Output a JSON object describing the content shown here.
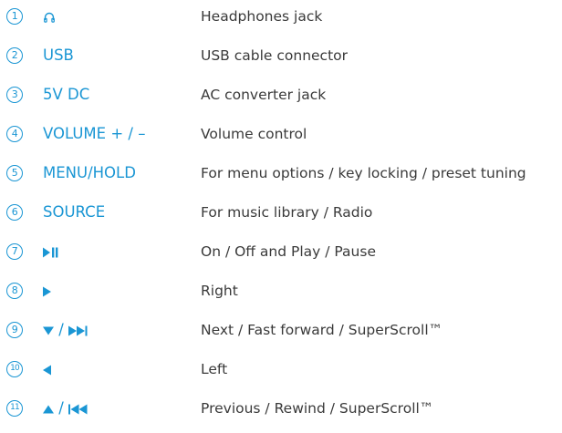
{
  "accent_color": "#1a96d4",
  "text_color": "#3a3a3a",
  "items": [
    {
      "number": "1",
      "key": "",
      "icon": "headphones-icon",
      "description": "Headphones jack"
    },
    {
      "number": "2",
      "key": "USB",
      "description": "USB cable connector"
    },
    {
      "number": "3",
      "key": "5V DC",
      "description": "AC converter jack"
    },
    {
      "number": "4",
      "key": "VOLUME + / –",
      "description": "Volume control"
    },
    {
      "number": "5",
      "key": "MENU/HOLD",
      "description": "For menu options / key locking / preset tuning"
    },
    {
      "number": "6",
      "key": "SOURCE",
      "description": "For music library / Radio"
    },
    {
      "number": "7",
      "key": "",
      "icon": "play-pause-icon",
      "description": "On / Off and Play / Pause"
    },
    {
      "number": "8",
      "key": "",
      "icon": "right-arrow-icon",
      "description": "Right"
    },
    {
      "number": "9",
      "key": " / ",
      "icon": "down-arrow-icon",
      "icon2": "fast-forward-icon",
      "description": "Next / Fast forward / SuperScroll™"
    },
    {
      "number": "10",
      "key": "",
      "icon": "left-arrow-icon",
      "description": "Left"
    },
    {
      "number": "11",
      "key": " / ",
      "icon": "up-arrow-icon",
      "icon2": "rewind-icon",
      "description": "Previous / Rewind / SuperScroll™"
    }
  ]
}
